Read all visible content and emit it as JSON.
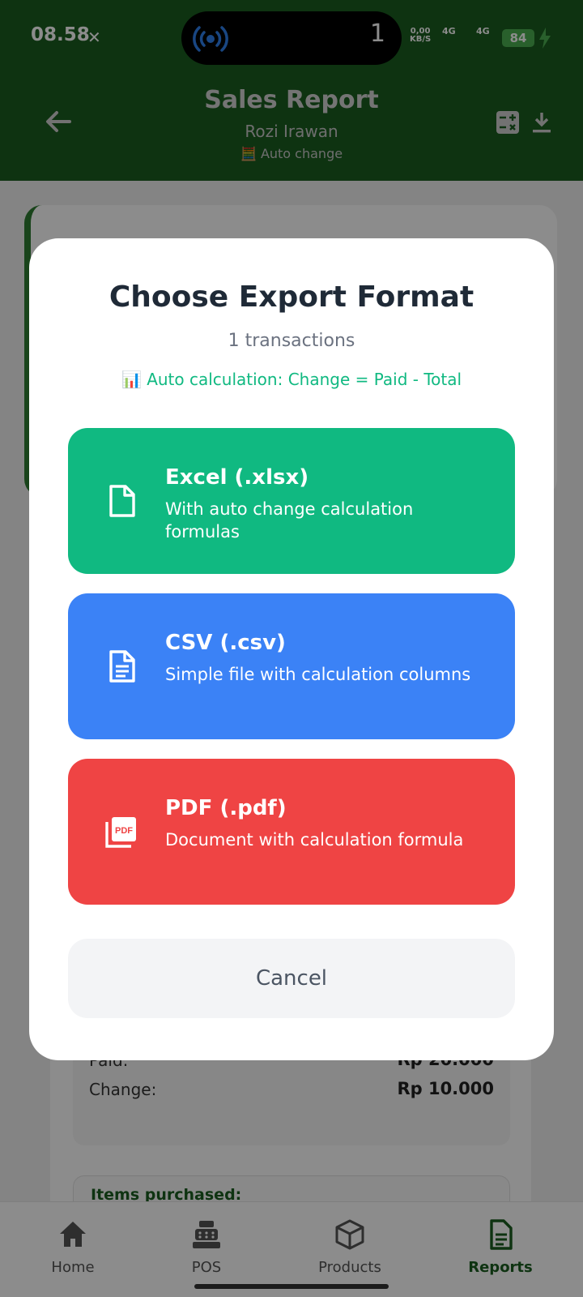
{
  "status_bar": {
    "time": "08.58",
    "island_count": "1",
    "net_speed_value": "0,00",
    "net_speed_unit": "KB/S",
    "signal1": "4G",
    "signal2": "4G",
    "battery": "84"
  },
  "header": {
    "title": "Sales Report",
    "subtitle": "Rozi Irawan",
    "auto_label": "🧮 Auto change"
  },
  "background": {
    "paid_label": "Paid:",
    "paid_value": "Rp 20.000",
    "change_label": "Change:",
    "change_value": "Rp 10.000",
    "items_label": "Items purchased:"
  },
  "modal": {
    "title": "Choose Export Format",
    "count": "1 transactions",
    "note": "📊 Auto calculation: Change = Paid - Total",
    "options": [
      {
        "title": "Excel (.xlsx)",
        "desc": "With auto change calculation formulas",
        "color": "#10b981",
        "icon": "file-icon"
      },
      {
        "title": "CSV (.csv)",
        "desc": "Simple file with calculation columns",
        "color": "#3b82f6",
        "icon": "document-lines-icon"
      },
      {
        "title": "PDF (.pdf)",
        "desc": "Document with calculation formula",
        "color": "#ef4444",
        "icon": "pdf-icon"
      }
    ],
    "cancel": "Cancel"
  },
  "nav": {
    "items": [
      {
        "label": "Home",
        "icon": "home-icon"
      },
      {
        "label": "POS",
        "icon": "cash-register-icon"
      },
      {
        "label": "Products",
        "icon": "box-icon"
      },
      {
        "label": "Reports",
        "icon": "report-icon",
        "active": true
      }
    ]
  }
}
